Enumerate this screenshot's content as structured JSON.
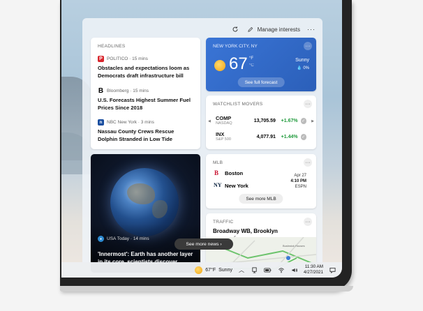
{
  "topbar": {
    "refresh_icon": "refresh-icon",
    "manage_label": "Manage interests",
    "more": "···"
  },
  "headlines": {
    "label": "HEADLINES",
    "items": [
      {
        "source": "POLITICO · 15 mins",
        "icon_letter": "P",
        "icon_color": "#d8262d",
        "title": "Obstacles and expectations loom as Democrats draft infrastructure bill"
      },
      {
        "source": "Bloomberg · 15 mins",
        "icon_letter": "B",
        "icon_color": "#000000",
        "title": "U.S. Forecasts Highest Summer Fuel Prices Since 2018"
      },
      {
        "source": "NBC New York · 3 mins",
        "icon_letter": "n",
        "icon_color": "#1a4fa0",
        "title": "Nassau County Crews Rescue Dolphin Stranded in Low Tide"
      }
    ]
  },
  "weather": {
    "location": "NEW YORK CITY, NY",
    "temp": "67",
    "unit_f": "°F",
    "unit_c": "°C",
    "condition": "Sunny",
    "precip": "💧 0%",
    "button": "See full forecast",
    "more": "···",
    "bg_color": "#2f67c6"
  },
  "watchlist": {
    "label": "WATCHLIST MOVERS",
    "more": "···",
    "rows": [
      {
        "symbol": "COMP",
        "exchange": "NASDAQ",
        "value": "13,705.59",
        "change": "+1.67%"
      },
      {
        "symbol": "INX",
        "exchange": "S&P 500",
        "value": "4,077.91",
        "change": "+1.44%"
      }
    ],
    "change_color": "#1f9a3b",
    "left_arrow": "◀",
    "right_arrow": "▶"
  },
  "news_image": {
    "source": "USA Today · 14 mins",
    "title": "'Innermost': Earth has another layer in its core, scientists discover"
  },
  "mlb": {
    "label": "MLB",
    "more": "···",
    "team1": "Boston",
    "team2": "New York",
    "date": "Apr 27",
    "time": "4:10 PM",
    "network": "ESPN",
    "button": "See more MLB"
  },
  "traffic": {
    "label": "TRAFFIC",
    "more": "···",
    "title": "Broadway WB, Brooklyn",
    "sub": "fic",
    "map_label": "Bushwick Houses"
  },
  "see_more_news": "See more news ›",
  "taskbar": {
    "weather_temp": "67°F",
    "weather_cond": "Sunny",
    "time": "11:30 AM",
    "date": "4/27/2021",
    "icons": [
      "chevron-up-icon",
      "network-icon",
      "battery-icon",
      "wifi-icon",
      "volume-icon",
      "notification-icon"
    ]
  }
}
